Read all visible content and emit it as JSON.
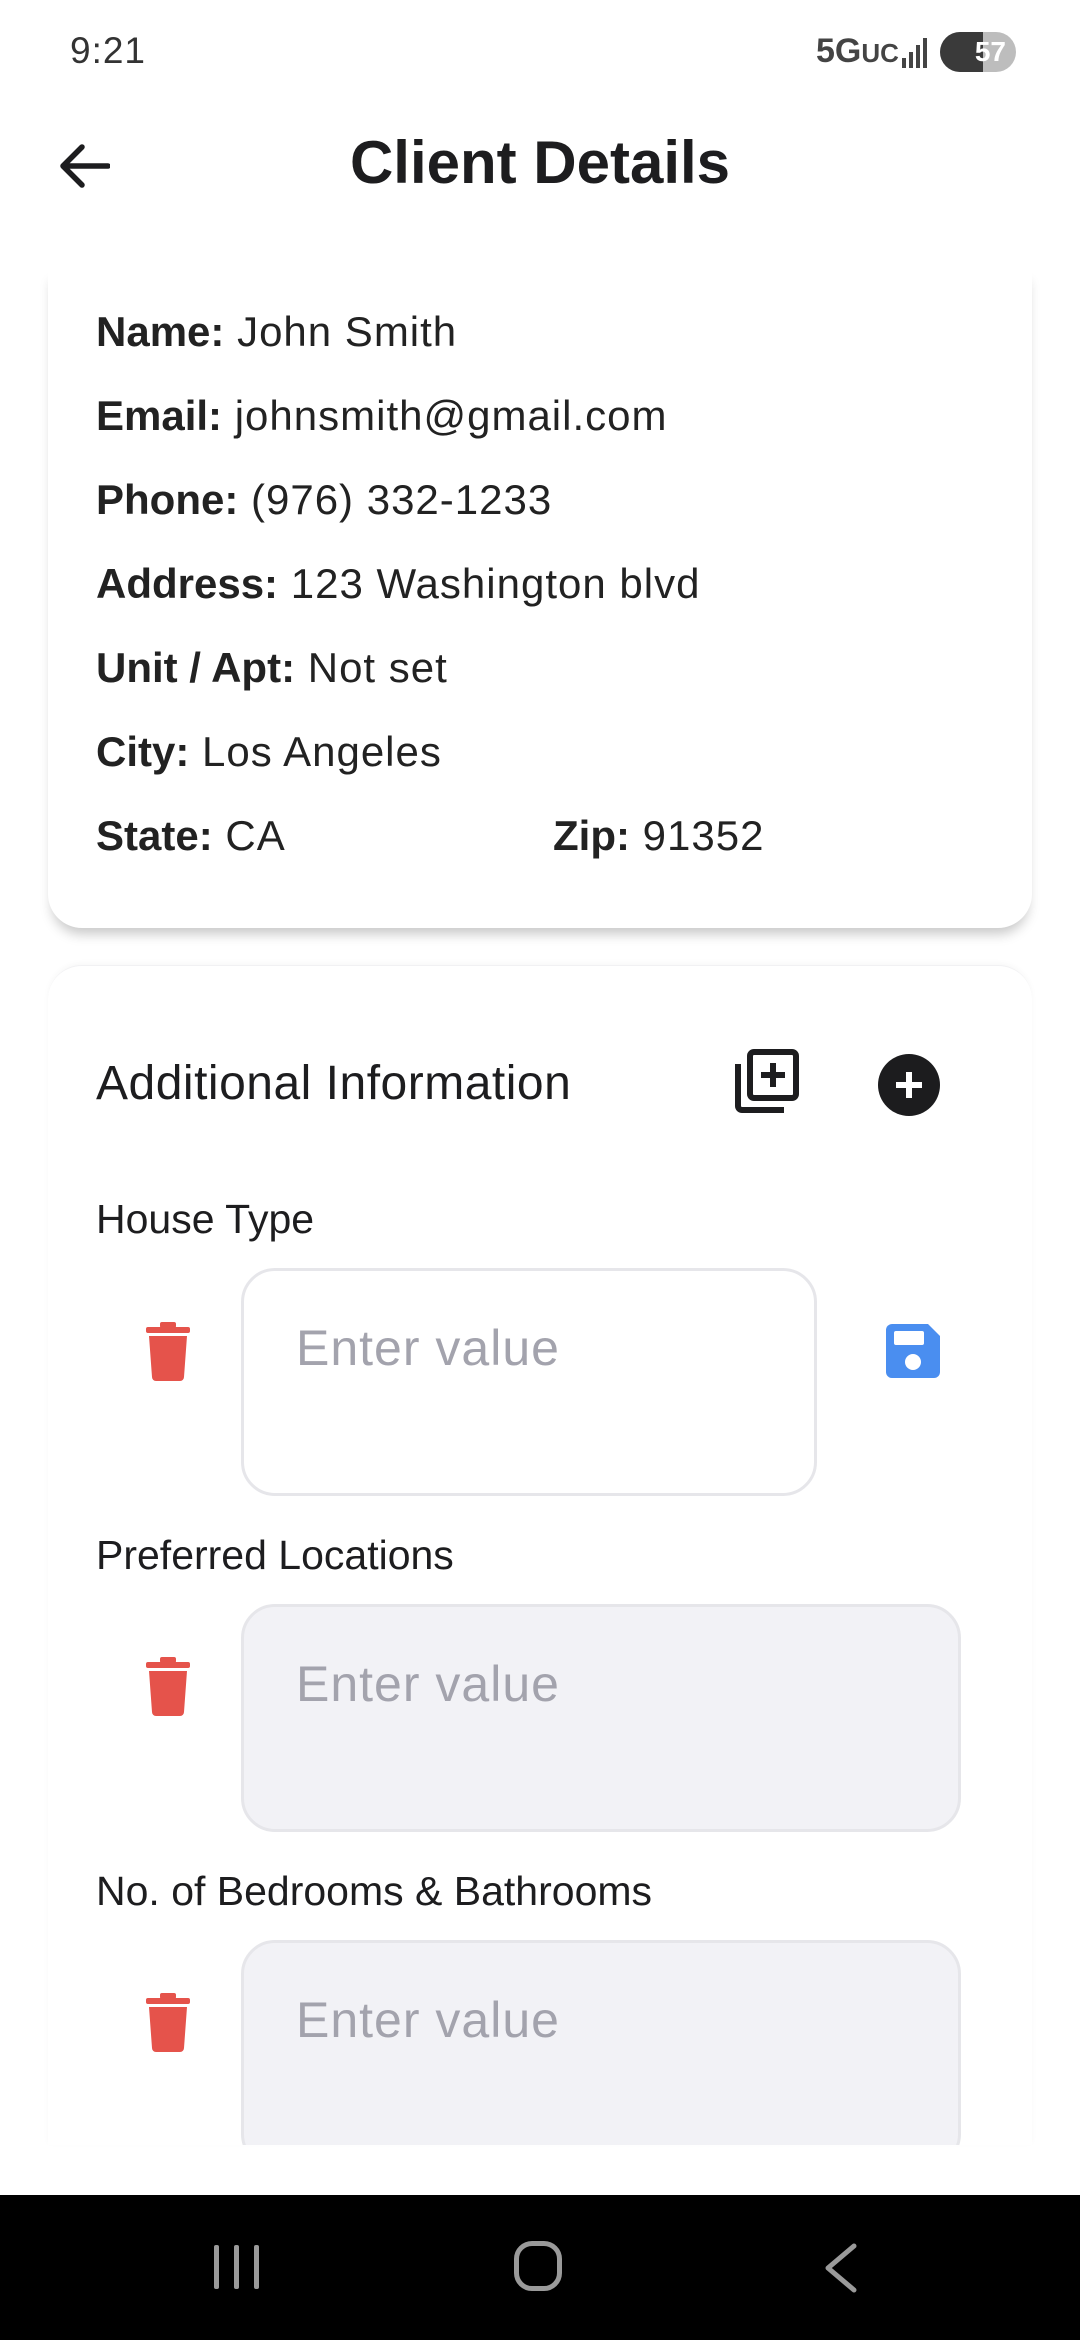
{
  "status_bar": {
    "time": "9:21",
    "network": "5G",
    "network_suffix": "UC",
    "battery_percent": 57,
    "battery_label": "57"
  },
  "app_bar": {
    "title": "Client Details",
    "back_icon": "arrow-left-icon"
  },
  "client": {
    "name_label": "Name:",
    "name": "John Smith",
    "email_label": "Email:",
    "email": "johnsmith@gmail.com",
    "phone_label": "Phone:",
    "phone": "(976) 332-1233",
    "address_label": "Address:",
    "address": "123 Washington blvd",
    "unit_label": "Unit / Apt:",
    "unit": "Not set",
    "city_label": "City:",
    "city": "Los Angeles",
    "state_label": "State:",
    "state": "CA",
    "zip_label": "Zip:",
    "zip": "91352"
  },
  "additional": {
    "title": "Additional Information",
    "copy_add_icon": "library-add-icon",
    "add_icon": "plus-circle-icon",
    "fields": [
      {
        "label": "House Type",
        "placeholder": "Enter value",
        "active": true
      },
      {
        "label": "Preferred Locations",
        "placeholder": "Enter value",
        "active": false
      },
      {
        "label": "No. of Bedrooms & Bathrooms",
        "placeholder": "Enter value",
        "active": false
      }
    ],
    "delete_icon": "trash-icon",
    "save_icon": "save-icon",
    "colors": {
      "delete": "#e5534b",
      "save": "#4a8ef0"
    }
  },
  "nav_bar": {
    "recent_icon": "recent-apps-icon",
    "home_icon": "home-icon",
    "back_icon": "back-chevron-icon"
  }
}
